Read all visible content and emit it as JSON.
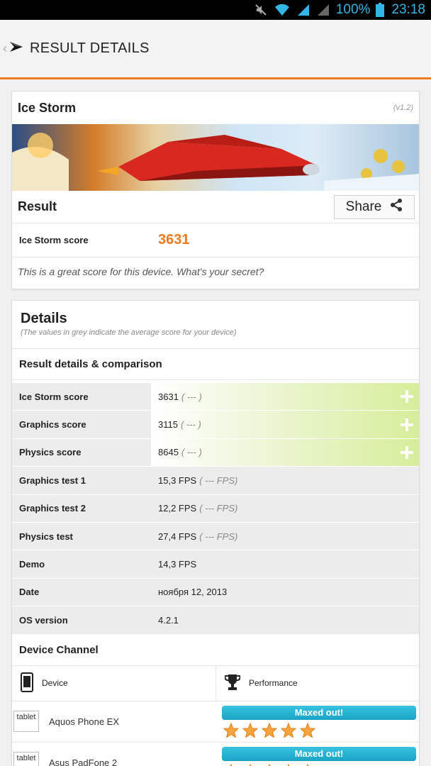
{
  "status": {
    "battery": "100%",
    "time": "23:18"
  },
  "header": {
    "title": "RESULT DETAILS"
  },
  "summary": {
    "test_name": "Ice Storm",
    "version": "(v1.2)",
    "result_label": "Result",
    "share_label": "Share",
    "score_label": "Ice Storm score",
    "score_value": "3631",
    "message": "This is a great score for this device. What's your secret?"
  },
  "details": {
    "title": "Details",
    "note": "(The values in grey indicate the average score for your device)",
    "subheading": "Result details & comparison",
    "rows": [
      {
        "label": "Ice Storm score",
        "value": "3631",
        "avg": "( --- )"
      },
      {
        "label": "Graphics score",
        "value": "3115",
        "avg": "( --- )"
      },
      {
        "label": "Physics score",
        "value": "8645",
        "avg": "( --- )"
      },
      {
        "label": "Graphics test 1",
        "value": "15,3 FPS",
        "avg": "( --- FPS)"
      },
      {
        "label": "Graphics test 2",
        "value": "12,2 FPS",
        "avg": "( --- FPS)"
      },
      {
        "label": "Physics test",
        "value": "27,4 FPS",
        "avg": "( --- FPS)"
      },
      {
        "label": "Demo",
        "value": "14,3 FPS",
        "avg": ""
      },
      {
        "label": "Date",
        "value": "ноября 12, 2013",
        "avg": ""
      },
      {
        "label": "OS version",
        "value": "4.2.1",
        "avg": ""
      }
    ]
  },
  "channel": {
    "title": "Device Channel",
    "col_device": "Device",
    "col_performance": "Performance",
    "devices": [
      {
        "type": "tablet",
        "name": "Aquos Phone EX",
        "performance": "Maxed out!",
        "stars": 5
      },
      {
        "type": "tablet",
        "name": "Asus PadFone 2",
        "performance": "Maxed out!",
        "stars": 5
      }
    ]
  },
  "colors": {
    "accent": "#f07a1e",
    "status_blue": "#33b5e5",
    "bar_blue": "#1aa3c6",
    "highlight_green": "#d6ee9a"
  }
}
